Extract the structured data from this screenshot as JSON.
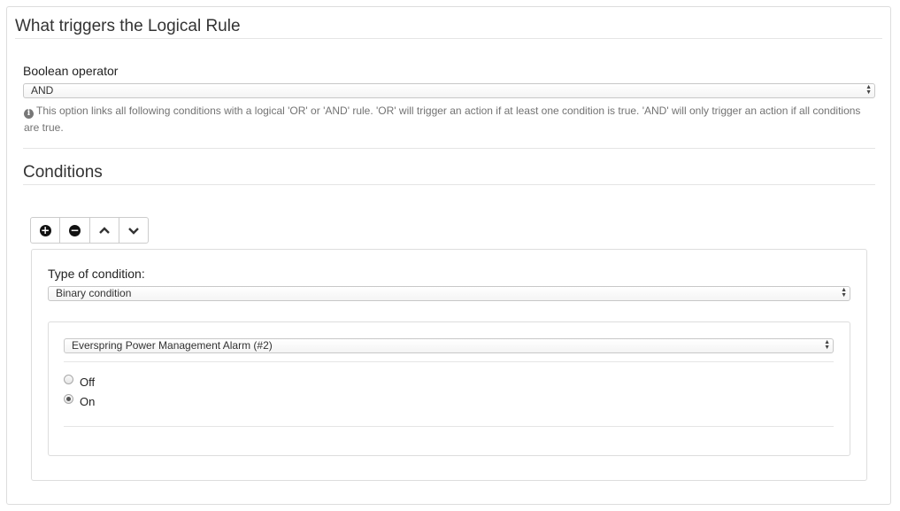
{
  "header": {
    "title": "What triggers the Logical Rule"
  },
  "operator": {
    "label": "Boolean operator",
    "selected": "AND",
    "help": "This option links all following conditions with a logical 'OR' or 'AND' rule. 'OR' will trigger an action if at least one condition is true. 'AND' will only trigger an action if all conditions are true."
  },
  "conditions": {
    "title": "Conditions",
    "toolbar": [
      "add-icon",
      "remove-icon",
      "chevron-up-icon",
      "chevron-down-icon"
    ],
    "type_label": "Type of condition:",
    "type_selected": "Binary condition",
    "device_selected": "Everspring Power Management Alarm (#2)",
    "options": [
      {
        "label": "Off",
        "checked": false
      },
      {
        "label": "On",
        "checked": true
      }
    ]
  }
}
